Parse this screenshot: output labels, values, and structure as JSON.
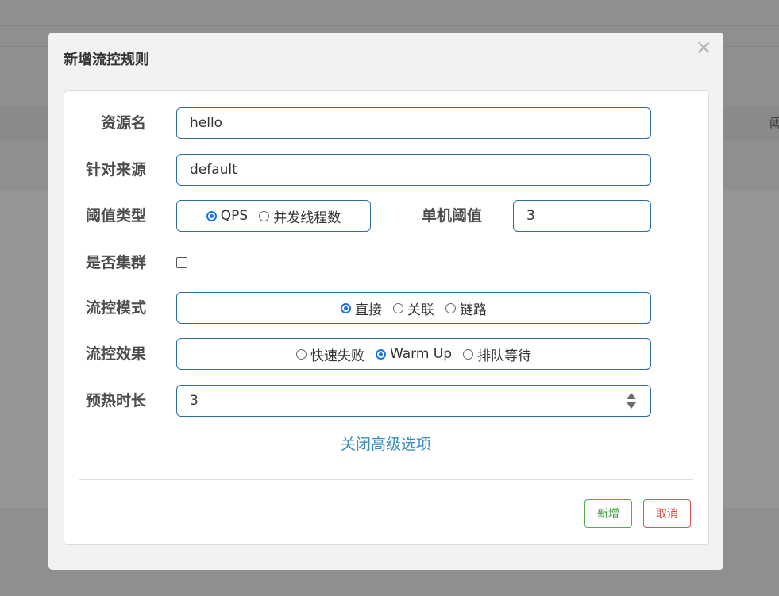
{
  "background": {
    "right_text": "阈"
  },
  "modal": {
    "title": "新增流控规则",
    "close_label": "×",
    "fields": {
      "resource": {
        "label": "资源名",
        "value": "hello"
      },
      "limit_app": {
        "label": "针对来源",
        "value": "default"
      },
      "grade": {
        "label": "阈值类型",
        "options": [
          "QPS",
          "并发线程数"
        ],
        "selected": "QPS"
      },
      "count": {
        "label": "单机阈值",
        "value": "3"
      },
      "cluster": {
        "label": "是否集群",
        "checked": false
      },
      "strategy": {
        "label": "流控模式",
        "options": [
          "直接",
          "关联",
          "链路"
        ],
        "selected": "直接"
      },
      "control_behavior": {
        "label": "流控效果",
        "options": [
          "快速失败",
          "Warm Up",
          "排队等待"
        ],
        "selected": "Warm Up"
      },
      "warmup": {
        "label": "预热时长",
        "value": "3"
      }
    },
    "advanced_link": "关闭高级选项",
    "buttons": {
      "add": "新增",
      "cancel": "取消"
    }
  },
  "colors": {
    "accent_blue": "#1a73e8",
    "border_blue": "#2f6ea3",
    "link_blue": "#3c8dbc",
    "success_green": "#3d9b3d",
    "danger_red": "#d9534f"
  }
}
